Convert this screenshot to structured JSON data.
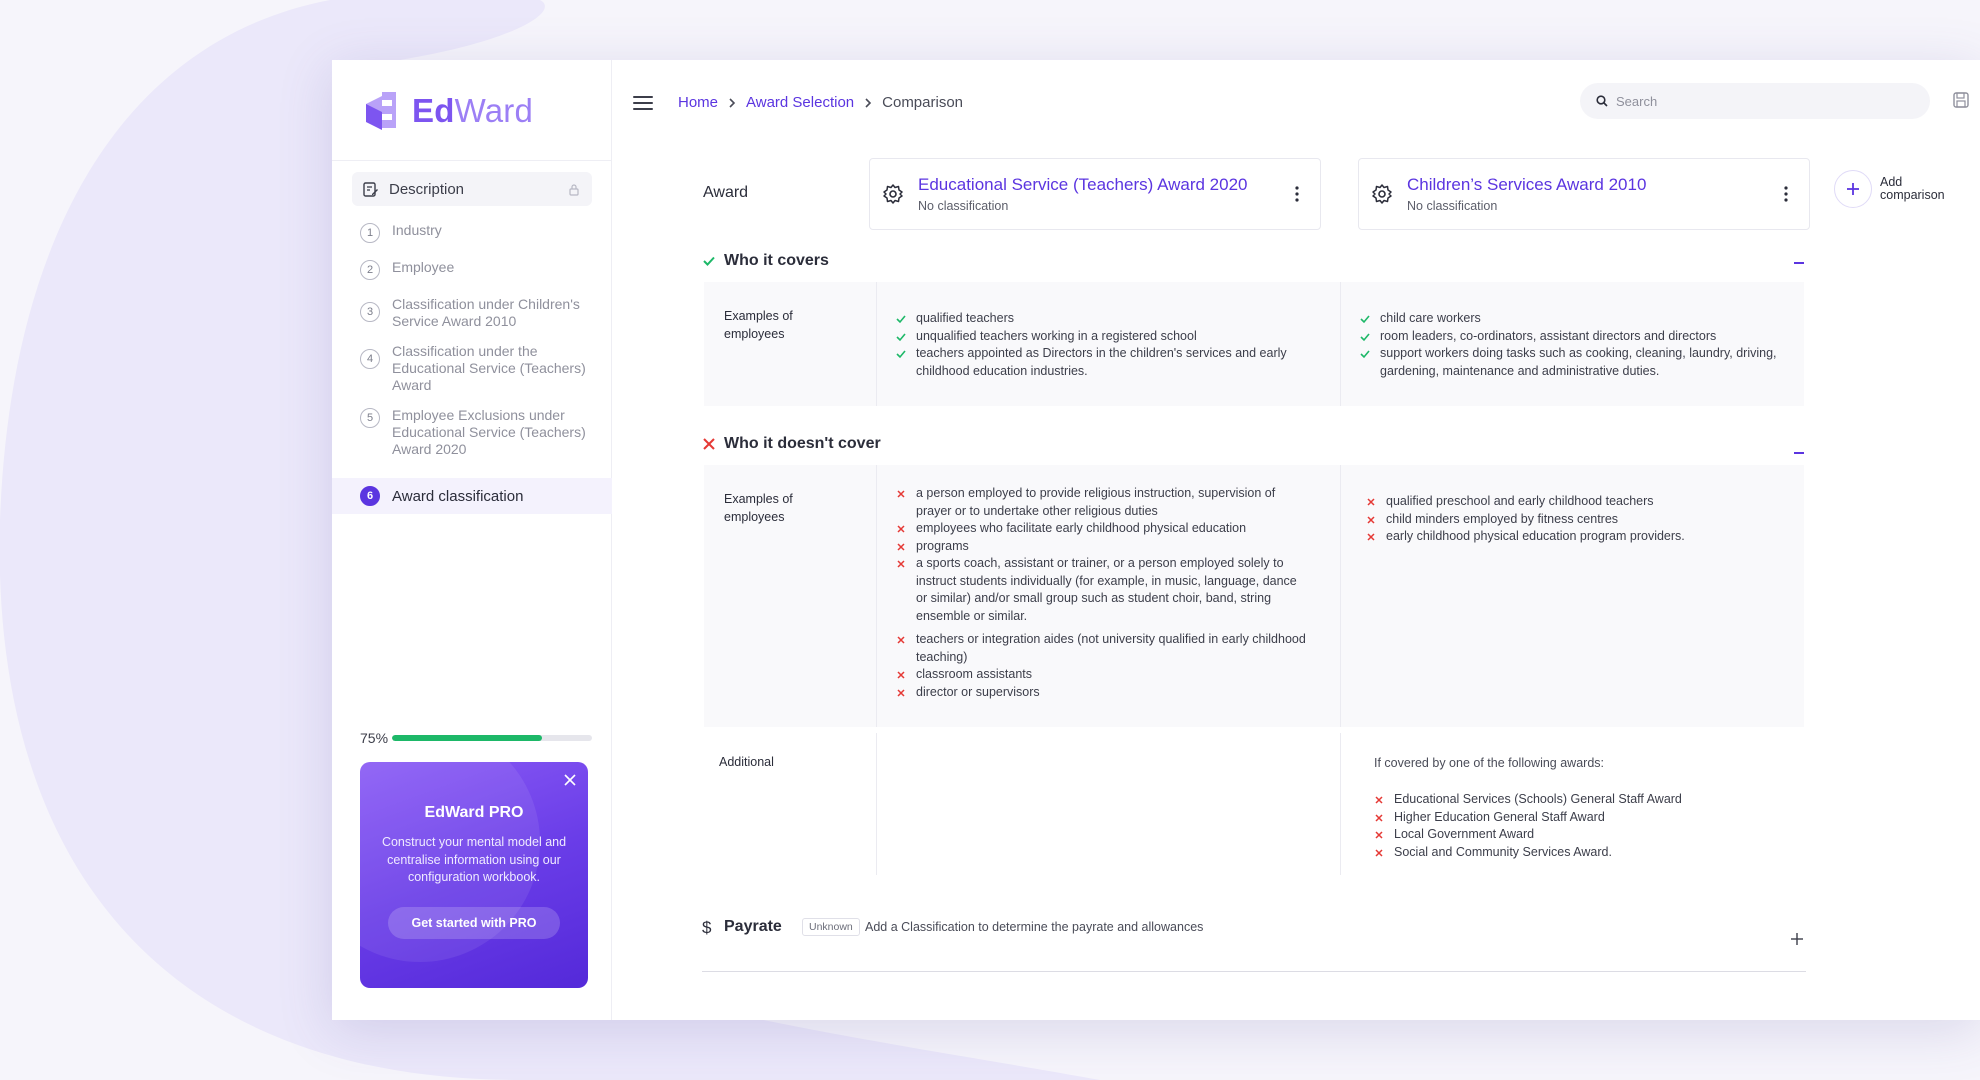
{
  "brand": {
    "name_bold": "Ed",
    "name_light": "Ward",
    "accent": "#5b35e0",
    "success": "#1db868",
    "danger": "#e53935"
  },
  "sidebar": {
    "description_label": "Description",
    "steps": [
      {
        "number": "1",
        "label": "Industry"
      },
      {
        "number": "2",
        "label": "Employee"
      },
      {
        "number": "3",
        "label": "Classification under Children's Service Award 2010"
      },
      {
        "number": "4",
        "label": "Classification under the Educational Service (Teachers) Award"
      },
      {
        "number": "5",
        "label": "Employee Exclusions under Educational Service (Teachers) Award 2020"
      }
    ],
    "active_step": {
      "number": "6",
      "label": "Award classification"
    },
    "progress": {
      "label": "75%",
      "value": 0.75
    },
    "pro": {
      "title": "EdWard PRO",
      "text": "Construct your mental model and centralise information using our configuration workbook.",
      "cta": "Get started with PRO"
    }
  },
  "topbar": {
    "breadcrumb": [
      {
        "label": "Home"
      },
      {
        "label": "Award Selection"
      },
      {
        "label": "Comparison"
      }
    ],
    "search_placeholder": "Search"
  },
  "comparison": {
    "award_label": "Award",
    "awards": [
      {
        "name": "Educational Service (Teachers) Award 2020",
        "classification": "No classification"
      },
      {
        "name": "Children’s Services Award 2010",
        "classification": "No classification"
      }
    ],
    "add_comparison": {
      "line1": "Add",
      "line2": "comparison"
    },
    "covers": {
      "title": "Who it covers",
      "row_label": "Examples of employees",
      "col1": [
        "qualified teachers",
        "unqualified teachers working in a registered school",
        "teachers appointed as Directors in the children's services and early childhood education industries."
      ],
      "col2": [
        "child care workers",
        "room leaders, co-ordinators, assistant directors and directors",
        "support workers doing tasks such as cooking, cleaning, laundry, driving, gardening, maintenance and administrative duties."
      ]
    },
    "not_covers": {
      "title": "Who it doesn't cover",
      "row_label": "Examples of employees",
      "col1": [
        "a person employed to provide religious instruction, supervision of prayer or to undertake other religious duties",
        "employees who facilitate early childhood physical education",
        "programs",
        "a sports coach, assistant or trainer, or a person employed solely to instruct students individually (for example, in music, language, dance or similar) and/or small group such as student choir, band, string ensemble or similar.",
        "teachers or integration aides (not university qualified in early childhood teaching)",
        "classroom assistants",
        "director or supervisors"
      ],
      "col2": [
        "qualified preschool and early childhood teachers",
        "child minders employed by fitness centres",
        "early childhood physical education program providers."
      ]
    },
    "additional": {
      "label": "Additional",
      "intro": "If covered by one of the following awards:",
      "items": [
        "Educational Services (Schools) General Staff Award",
        "Higher Education General Staff Award",
        "Local Government Award",
        "Social and Community Services Award."
      ]
    },
    "payrate": {
      "symbol": "$",
      "title": "Payrate",
      "badge": "Unknown",
      "hint": "Add a Classification to determine the payrate and allowances"
    }
  }
}
